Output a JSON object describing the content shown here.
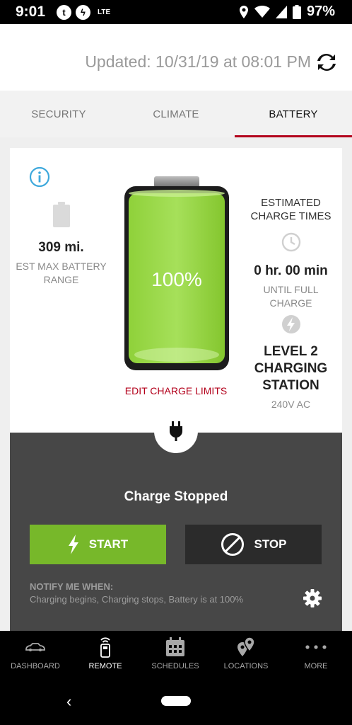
{
  "status_bar": {
    "time": "9:01",
    "network": "LTE",
    "battery_percent": "97%",
    "icons": [
      "notification-t-icon",
      "charging-app-icon",
      "location-icon",
      "wifi-icon",
      "signal-icon",
      "battery-icon"
    ]
  },
  "header": {
    "updated_text": "Updated: 10/31/19 at 08:01 PM",
    "refresh_icon": "refresh-icon"
  },
  "tabs": [
    {
      "label": "SECURITY",
      "active": false
    },
    {
      "label": "CLIMATE",
      "active": false
    },
    {
      "label": "BATTERY",
      "active": true
    }
  ],
  "battery": {
    "range_value": "309 mi.",
    "range_label": "EST MAX BATTERY RANGE",
    "percent": "100%",
    "level_fraction": 1.0,
    "edit_limits": "EDIT CHARGE LIMITS",
    "estimated_title": "ESTIMATED CHARGE TIMES",
    "charge_time": "0 hr. 00 min",
    "until_label": "UNTIL FULL CHARGE",
    "station_level": "LEVEL 2 CHARGING STATION",
    "voltage": "240V AC"
  },
  "control": {
    "status": "Charge Stopped",
    "start_label": "START",
    "stop_label": "STOP",
    "notify_title": "NOTIFY ME WHEN:",
    "notify_text": "Charging begins, Charging stops, Battery is at 100%"
  },
  "bottom_nav": [
    {
      "label": "DASHBOARD",
      "icon": "car-icon",
      "active": false
    },
    {
      "label": "REMOTE",
      "icon": "remote-icon",
      "active": true
    },
    {
      "label": "SCHEDULES",
      "icon": "calendar-icon",
      "active": false
    },
    {
      "label": "LOCATIONS",
      "icon": "map-pin-icon",
      "active": false
    },
    {
      "label": "MORE",
      "icon": "more-dots-icon",
      "active": false
    }
  ],
  "colors": {
    "accent_red": "#b3001b",
    "start_green": "#77b82a",
    "panel_gray": "#474747",
    "info_blue": "#3fa9dc"
  }
}
